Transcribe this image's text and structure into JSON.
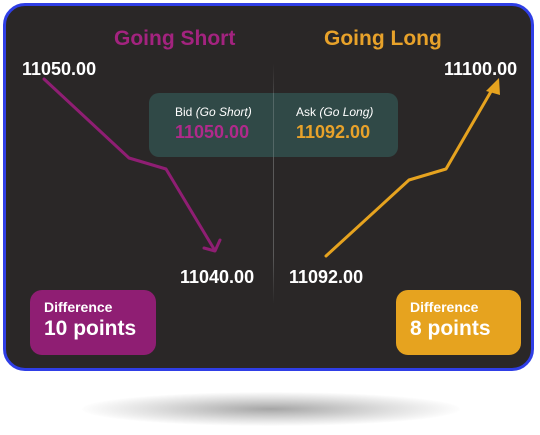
{
  "colors": {
    "frame_border": "#2f3ee6",
    "panel_background": "#2a2727",
    "short_accent": "#a3237f",
    "long_accent": "#e8a22a",
    "quote_box": "#304947"
  },
  "short": {
    "heading": "Going Short",
    "start_price": "11050.00",
    "end_price": "11040.00",
    "difference_label": "Difference",
    "difference_value": "10 points",
    "arrow_icon": "down-arrow-icon"
  },
  "long": {
    "heading": "Going Long",
    "start_price": "11092.00",
    "end_price": "11100.00",
    "difference_label": "Difference",
    "difference_value": "8 points",
    "arrow_icon": "up-arrow-icon"
  },
  "quote": {
    "bid": {
      "label": "Bid",
      "note": "(Go Short)",
      "value": "11050.00"
    },
    "ask": {
      "label": "Ask",
      "note": "(Go Long)",
      "value": "11092.00"
    }
  }
}
